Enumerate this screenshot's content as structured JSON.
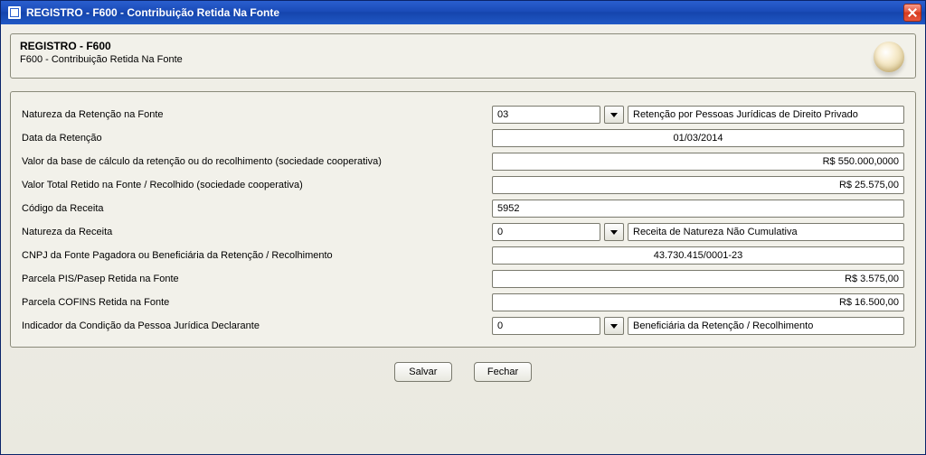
{
  "window": {
    "title": "REGISTRO - F600 - Contribuição Retida Na Fonte"
  },
  "header": {
    "title": "REGISTRO - F600",
    "subtitle": "F600 - Contribuição Retida Na Fonte"
  },
  "labels": {
    "natureza_retencao": "Natureza da Retenção na Fonte",
    "data_retencao": "Data da Retenção",
    "valor_base": "Valor da base de cálculo da retenção ou do recolhimento (sociedade cooperativa)",
    "valor_total_retido": "Valor Total Retido na Fonte / Recolhido (sociedade cooperativa)",
    "codigo_receita": "Código da Receita",
    "natureza_receita": "Natureza da Receita",
    "cnpj": "CNPJ da Fonte Pagadora ou Beneficiária da Retenção / Recolhimento",
    "parcela_pis": "Parcela PIS/Pasep Retida na Fonte",
    "parcela_cofins": "Parcela COFINS Retida na Fonte",
    "indicador": "Indicador da Condição da Pessoa Jurídica Declarante"
  },
  "values": {
    "natureza_retencao_code": "03",
    "natureza_retencao_desc": "Retenção por Pessoas Jurídicas de Direito Privado",
    "data_retencao": "01/03/2014",
    "valor_base": "R$ 550.000,0000",
    "valor_total_retido": "R$ 25.575,00",
    "codigo_receita": "5952",
    "natureza_receita_code": "0",
    "natureza_receita_desc": "Receita de Natureza Não Cumulativa",
    "cnpj": "43.730.415/0001-23",
    "parcela_pis": "R$ 3.575,00",
    "parcela_cofins": "R$ 16.500,00",
    "indicador_code": "0",
    "indicador_desc": "Beneficiária da Retenção / Recolhimento"
  },
  "buttons": {
    "salvar": "Salvar",
    "fechar": "Fechar"
  }
}
